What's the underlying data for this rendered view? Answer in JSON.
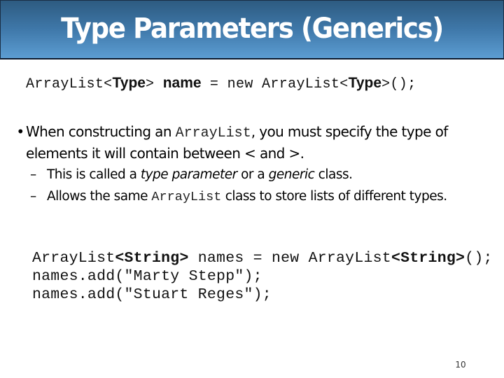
{
  "slide": {
    "title": "Type Parameters (Generics)",
    "colors": {
      "header_top": "#2d5b80",
      "header_bottom": "#5c9dd2",
      "header_border": "#0d1a2e",
      "title_text": "#ffffff"
    },
    "declaration": {
      "part1": "ArrayList<",
      "type1": "Type",
      "part2": "> ",
      "name": "name",
      "part3": " = new ArrayList<",
      "type2": "Type",
      "part4": ">();"
    },
    "bullet": {
      "symbol": "•",
      "text_before": "When constructing an ",
      "code": "ArrayList",
      "text_after": ", you must specify the type of elements it will contain between < and >."
    },
    "sub_bullets": [
      {
        "symbol": "–",
        "text_before": "This is called a ",
        "italic1": "type parameter",
        "text_middle": " or a ",
        "italic2": "generic",
        "text_after": " class."
      },
      {
        "symbol": "–",
        "text_before": "Allows the same ",
        "code": "ArrayList",
        "text_after": " class to store lists of different types."
      }
    ],
    "code_example": {
      "line1_a": "ArrayList",
      "line1_b": "<String>",
      "line1_c": " names = new ArrayList",
      "line1_d": "<String>",
      "line1_e": "();",
      "line2": "names.add(\"Marty Stepp\");",
      "line3": "names.add(\"Stuart Reges\");"
    },
    "page_number": "10"
  }
}
